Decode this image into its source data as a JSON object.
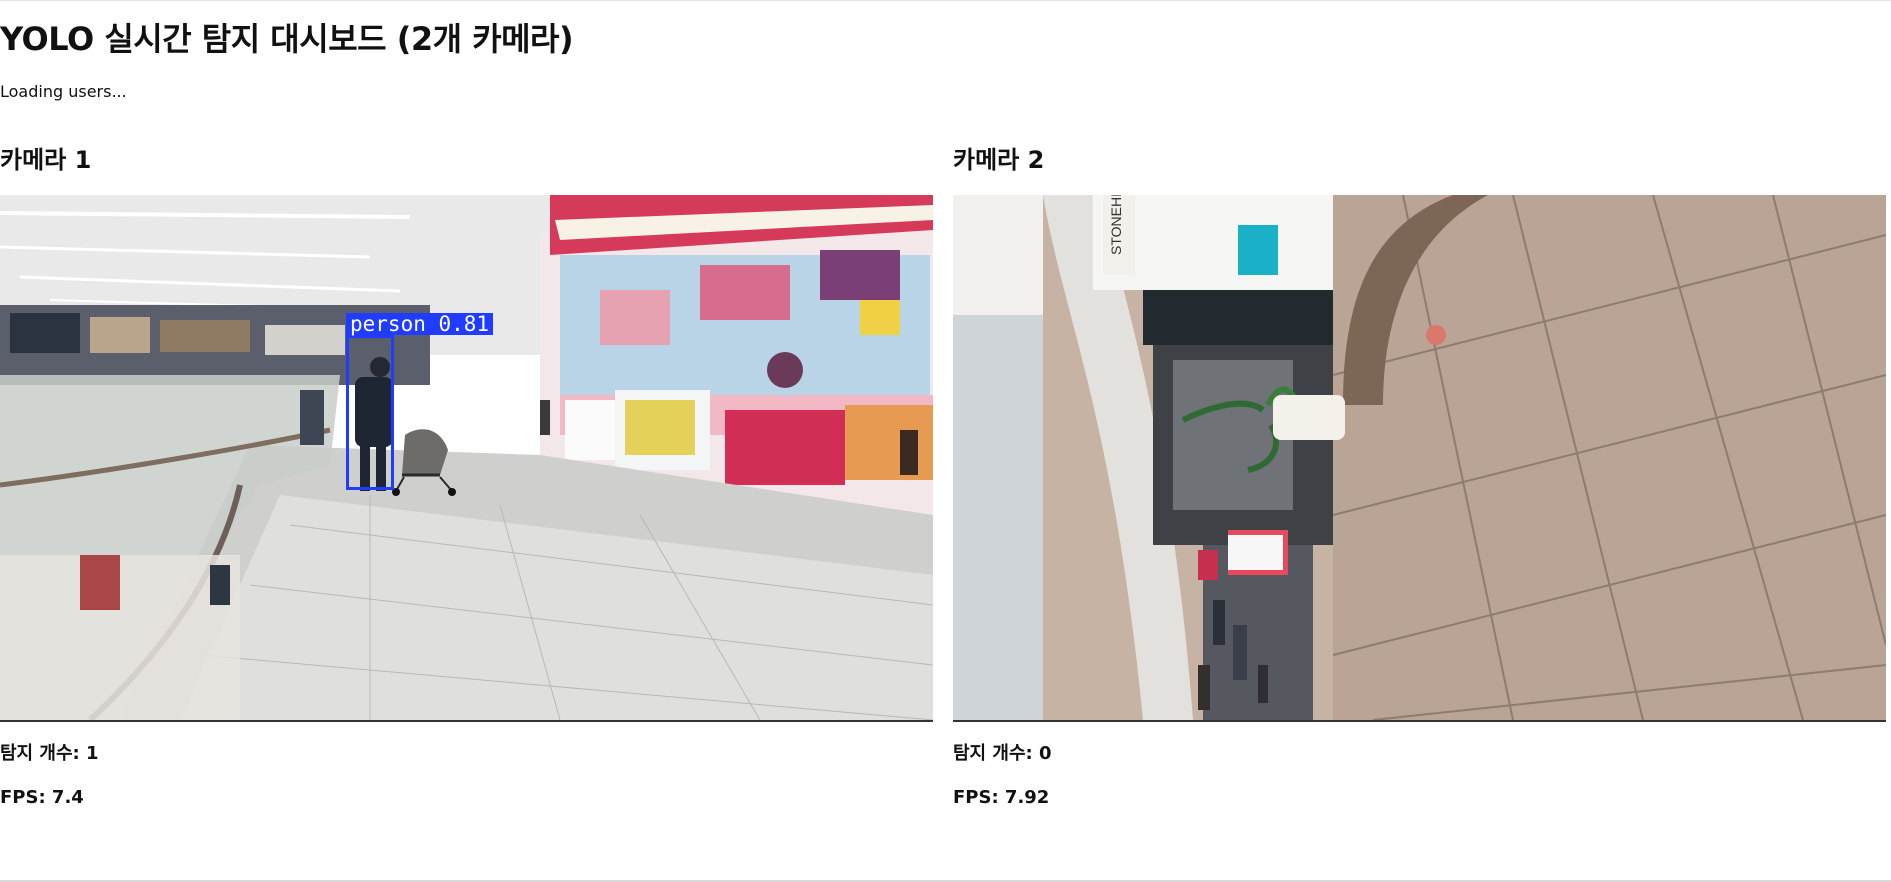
{
  "page": {
    "title": "YOLO 실시간 탐지 대시보드 (2개 카메라)",
    "status": "Loading users..."
  },
  "cameras": [
    {
      "title": "카메라 1",
      "count_text": "탐지 개수: 1",
      "fps_text": "FPS: 7.4",
      "detection": {
        "label": "person 0.81",
        "color": "#1f3cff"
      }
    },
    {
      "title": "카메라 2",
      "count_text": "탐지 개수: 0",
      "fps_text": "FPS: 7.92"
    }
  ],
  "sign_text": {
    "stonehill": "STONEHILL"
  }
}
